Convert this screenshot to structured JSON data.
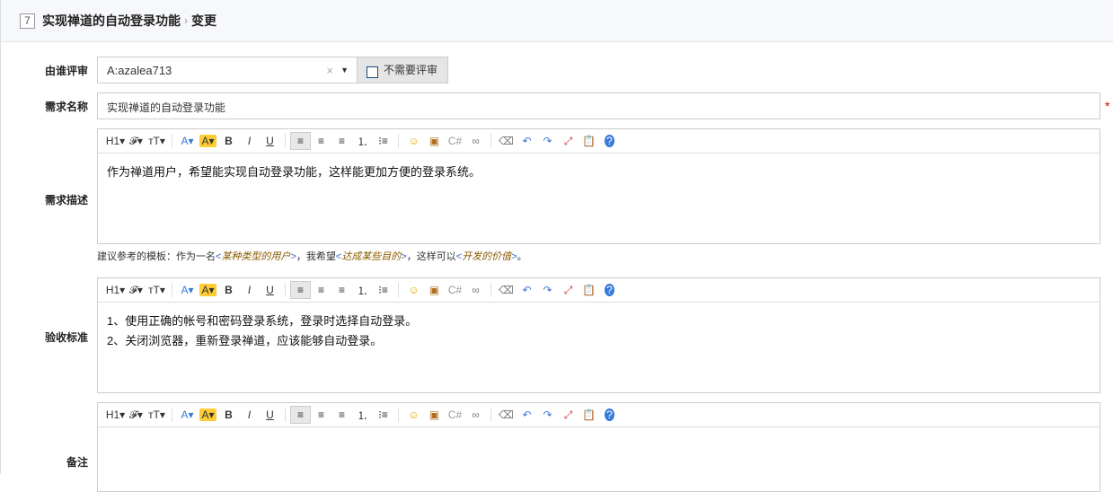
{
  "header": {
    "id": "7",
    "title": "实现禅道的自动登录功能",
    "separator": "›",
    "action": "变更"
  },
  "form": {
    "reviewer": {
      "label": "由谁评审",
      "value": "A:azalea713",
      "clear_icon": "×",
      "no_review_label": "不需要评审"
    },
    "name": {
      "label": "需求名称",
      "value": "实现禅道的自动登录功能",
      "required_mark": "*"
    },
    "description": {
      "label": "需求描述",
      "lines": [
        "作为禅道用户，希望能实现自动登录功能，这样能更加方便的登录系统。"
      ]
    },
    "hint": {
      "prefix": "建议参考的模板：作为一名",
      "p1": "某种类型的用户",
      "mid1": "，我希望",
      "p2": "达成某些目的",
      "mid2": "，这样可以",
      "p3": "开发的价值",
      "suffix": "。",
      "lt": "<",
      "gt": ">"
    },
    "acceptance": {
      "label": "验收标准",
      "lines": [
        "1、使用正确的帐号和密码登录系统，登录时选择自动登录。",
        "2、关闭浏览器，重新登录禅道，应该能够自动登录。"
      ]
    },
    "note": {
      "label": "备注",
      "lines": []
    }
  },
  "toolbar": [
    {
      "name": "heading",
      "glyph": "H1▾"
    },
    {
      "name": "font-family",
      "glyph": "𝓕▾"
    },
    {
      "name": "font-size",
      "glyph": "тT▾"
    },
    {
      "sep": true
    },
    {
      "name": "font-color",
      "glyph": "A▾",
      "color": "#3a7ad8"
    },
    {
      "name": "highlight",
      "glyph": "A▾",
      "bg": "#ffcc33"
    },
    {
      "name": "bold",
      "glyph": "B"
    },
    {
      "name": "italic",
      "glyph": "I"
    },
    {
      "name": "underline",
      "glyph": "U"
    },
    {
      "sep": true
    },
    {
      "name": "align-left",
      "glyph": "≡"
    },
    {
      "name": "align-center",
      "glyph": "≡"
    },
    {
      "name": "align-right",
      "glyph": "≡"
    },
    {
      "name": "ordered-list",
      "glyph": "⒈"
    },
    {
      "name": "unordered-list",
      "glyph": "⁝≡"
    },
    {
      "sep": true
    },
    {
      "name": "emoticon",
      "glyph": "☺",
      "color": "#e0a800"
    },
    {
      "name": "image",
      "glyph": "▣",
      "color": "#b07020"
    },
    {
      "name": "code",
      "glyph": "C#",
      "color": "#999"
    },
    {
      "name": "link",
      "glyph": "∞",
      "color": "#778"
    },
    {
      "sep": true
    },
    {
      "name": "eraser",
      "glyph": "⌫",
      "color": "#777"
    },
    {
      "name": "undo",
      "glyph": "↶",
      "color": "#3a7ad8"
    },
    {
      "name": "redo",
      "glyph": "↷",
      "color": "#3a7ad8"
    },
    {
      "name": "fullscreen",
      "glyph": "⤢",
      "color": "#c33"
    },
    {
      "name": "paste",
      "glyph": "📋",
      "color": "#555"
    },
    {
      "name": "help",
      "glyph": "?",
      "color": "#fff",
      "bg": "#3a7ad8"
    }
  ]
}
